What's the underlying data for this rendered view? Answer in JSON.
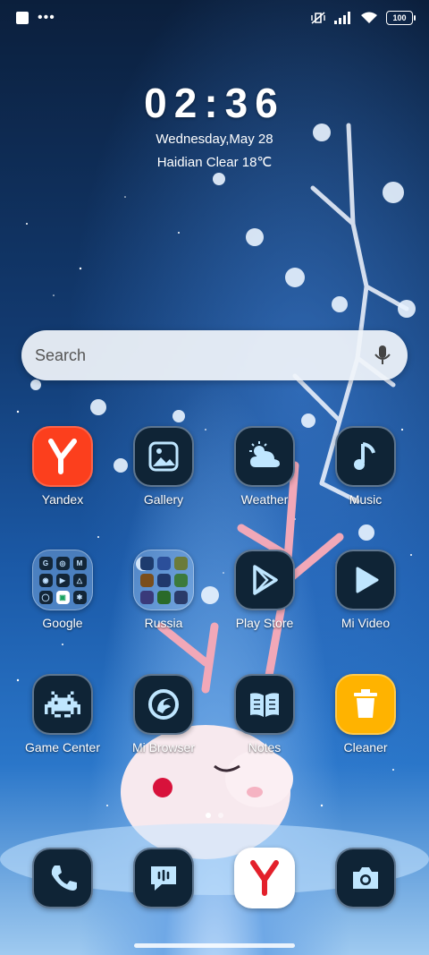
{
  "status_bar": {
    "battery": "100",
    "icons": [
      "square-icon",
      "more-dots-icon",
      "vibrate-off-icon",
      "signal-icon",
      "wifi-icon",
      "battery-icon"
    ]
  },
  "lockclock": {
    "time": "02:36",
    "date": "Wednesday,May 28",
    "weather": "Haidian Clear 18℃"
  },
  "search": {
    "placeholder": "Search"
  },
  "apps": [
    {
      "label": "Yandex",
      "icon": "yandex-y-icon"
    },
    {
      "label": "Gallery",
      "icon": "image-icon"
    },
    {
      "label": "Weather",
      "icon": "cloud-sun-icon"
    },
    {
      "label": "Music",
      "icon": "music-note-icon"
    },
    {
      "label": "Google",
      "icon": "folder-icon"
    },
    {
      "label": "Russia",
      "icon": "folder-icon"
    },
    {
      "label": "Play Store",
      "icon": "play-store-icon"
    },
    {
      "label": "Mi Video",
      "icon": "play-icon"
    },
    {
      "label": "Game Center",
      "icon": "space-invader-icon"
    },
    {
      "label": "Mi Browser",
      "icon": "browser-icon"
    },
    {
      "label": "Notes",
      "icon": "notes-book-icon"
    },
    {
      "label": "Cleaner",
      "icon": "trash-icon"
    }
  ],
  "dock": [
    {
      "icon": "phone-icon"
    },
    {
      "icon": "message-icon"
    },
    {
      "icon": "yandex-browser-icon"
    },
    {
      "icon": "camera-icon"
    }
  ],
  "colors": {
    "yandex_red": "#fc3f1d",
    "cleaner_yellow": "#ffb300",
    "icon_bg": "#0f2436",
    "icon_glyph": "#bfe6ff"
  }
}
